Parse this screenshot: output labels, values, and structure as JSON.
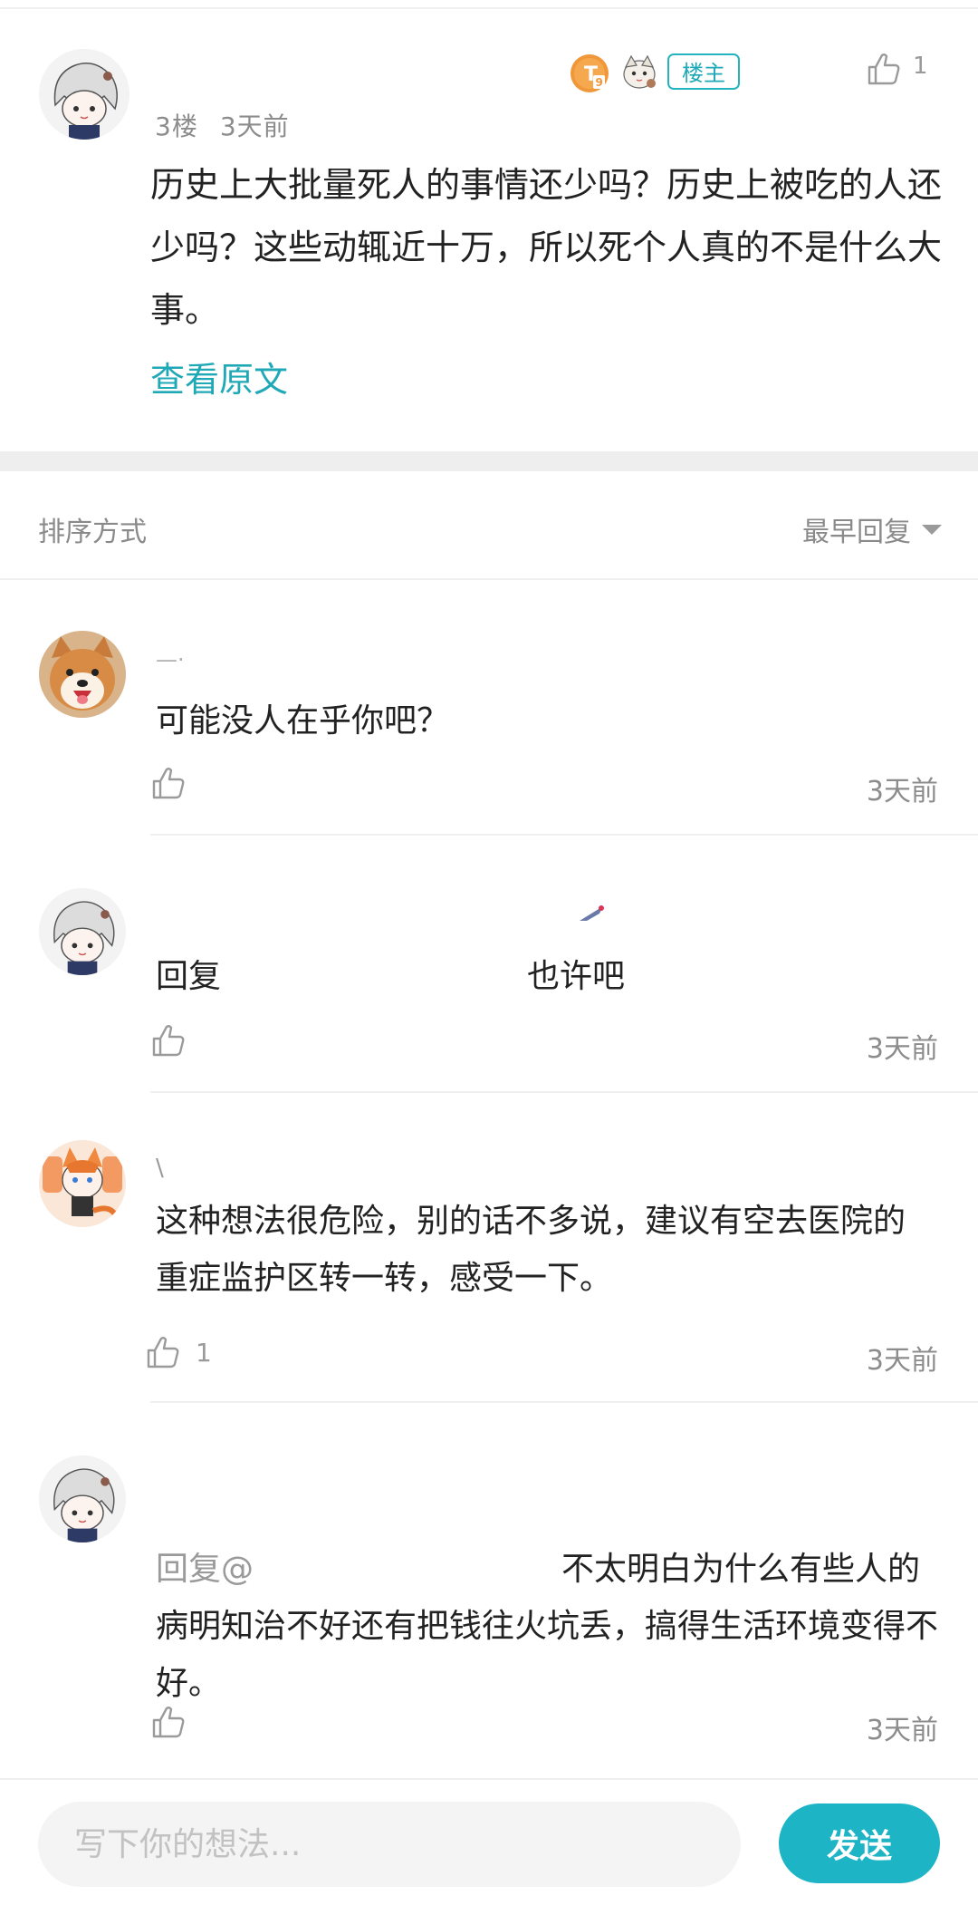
{
  "post": {
    "floor": "3楼",
    "time": "3天前",
    "op_tag": "楼主",
    "like_count": "1",
    "text": "历史上大批量死人的事情还少吗？历史上被吃的人还少吗？这些动辄近十万，所以死个人真的不是什么大事。",
    "view_original": "查看原文",
    "icons": [
      "level-t-badge-icon",
      "sticker-badge-icon",
      "thumbs-up-icon"
    ]
  },
  "sort": {
    "label": "排序方式",
    "selected": "最早回复"
  },
  "comments": [
    {
      "text": "可能没人在乎你吧？",
      "like_count": "",
      "time": "3天前"
    },
    {
      "reply_prefix": "回复",
      "text": "也许吧",
      "like_count": "",
      "time": "3天前"
    },
    {
      "text": "这种想法很危险，别的话不多说，建议有空去医院的重症监护区转一转，感受一下。",
      "like_count": "1",
      "time": "3天前"
    },
    {
      "reply_prefix": "回复@",
      "text": "不太明白为什么有些人的病明知治不好还有把钱往火坑丢，搞得生活环境变得不好。",
      "like_count": "",
      "time": "3天前"
    }
  ],
  "composer": {
    "placeholder": "写下你的想法...",
    "send_label": "发送"
  },
  "colors": {
    "accent": "#1db4c6",
    "link": "#1fa8b6",
    "divider": "#eeeeee"
  }
}
